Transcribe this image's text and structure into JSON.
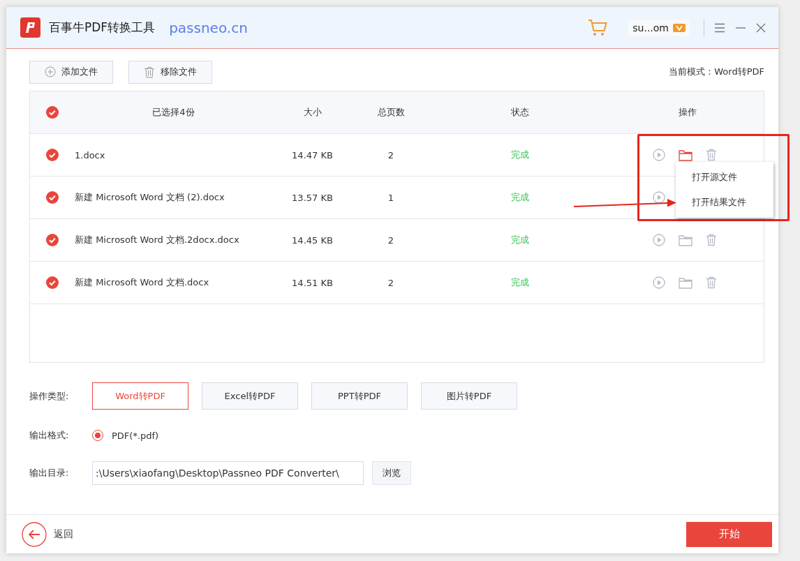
{
  "window": {
    "app_name": "百事牛PDF转换工具",
    "site": "passneo.cn",
    "user": "su...om"
  },
  "toolbar": {
    "buttons": [
      {
        "kind": "add",
        "label": "添加文件"
      },
      {
        "kind": "remove",
        "label": "移除文件"
      }
    ],
    "mode": "当前模式：Word转PDF"
  },
  "table": {
    "all_checked": true,
    "columns": [
      "已选择4份",
      "大小",
      "总页数",
      "状态",
      "操作"
    ],
    "rows": [
      {
        "checked": true,
        "name": "1.docx",
        "size": "14.47 KB",
        "pages": "2",
        "status": "完成",
        "folder_hovered": true,
        "covered_by_menu": false
      },
      {
        "checked": true,
        "name": "新建 Microsoft Word 文档 (2).docx",
        "size": "13.57 KB",
        "pages": "1",
        "status": "完成",
        "covered_by_menu": true
      },
      {
        "checked": true,
        "name": "新建 Microsoft Word 文档.2docx.docx",
        "size": "14.45 KB",
        "pages": "2",
        "status": "完成",
        "folder_hovered": false,
        "covered_by_menu": false
      },
      {
        "checked": true,
        "name": "新建 Microsoft Word 文档.docx",
        "size": "14.51 KB",
        "pages": "2",
        "status": "完成",
        "folder_hovered": false,
        "covered_by_menu": false
      }
    ]
  },
  "context_menu": {
    "items": [
      "打开源文件",
      "打开结果文件"
    ]
  },
  "settings": {
    "type_label": "操作类型:",
    "types": [
      {
        "label": "Word转PDF",
        "selected": true
      },
      {
        "label": "Excel转PDF",
        "selected": false
      },
      {
        "label": "PPT转PDF",
        "selected": false
      },
      {
        "label": "图片转PDF",
        "selected": false
      }
    ],
    "format_label": "输出格式:",
    "format": {
      "label": "PDF(*.pdf)",
      "checked": true
    },
    "dir_label": "输出目录:",
    "dir": ":\\Users\\xiaofang\\Desktop\\Passneo PDF Converter\\",
    "browse": "浏览"
  },
  "footer": {
    "back": "返回",
    "start": "开始"
  }
}
